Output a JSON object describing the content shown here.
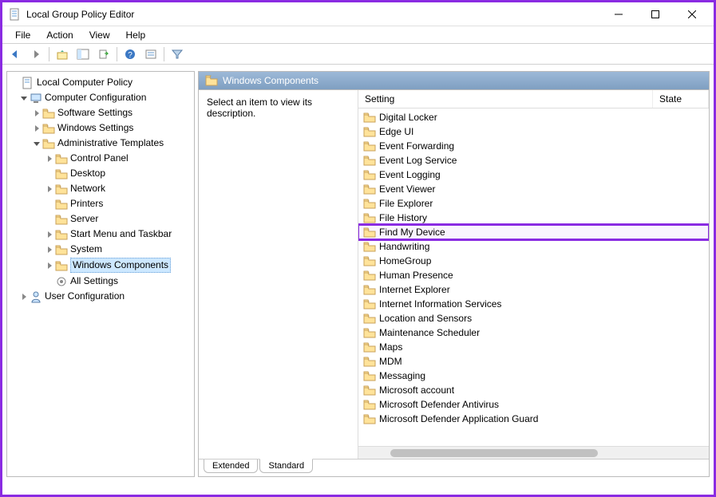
{
  "window": {
    "title": "Local Group Policy Editor"
  },
  "menu": {
    "items": [
      "File",
      "Action",
      "View",
      "Help"
    ]
  },
  "tree": {
    "root": "Local Computer Policy",
    "nodes": [
      {
        "label": "Computer Configuration",
        "level": 1,
        "twist": "open",
        "icon": "computer"
      },
      {
        "label": "Software Settings",
        "level": 2,
        "twist": "closed",
        "icon": "folder"
      },
      {
        "label": "Windows Settings",
        "level": 2,
        "twist": "closed",
        "icon": "folder"
      },
      {
        "label": "Administrative Templates",
        "level": 2,
        "twist": "open",
        "icon": "folder"
      },
      {
        "label": "Control Panel",
        "level": 3,
        "twist": "closed",
        "icon": "folder"
      },
      {
        "label": "Desktop",
        "level": 3,
        "twist": "none",
        "icon": "folder"
      },
      {
        "label": "Network",
        "level": 3,
        "twist": "closed",
        "icon": "folder"
      },
      {
        "label": "Printers",
        "level": 3,
        "twist": "none",
        "icon": "folder"
      },
      {
        "label": "Server",
        "level": 3,
        "twist": "none",
        "icon": "folder"
      },
      {
        "label": "Start Menu and Taskbar",
        "level": 3,
        "twist": "closed",
        "icon": "folder"
      },
      {
        "label": "System",
        "level": 3,
        "twist": "closed",
        "icon": "folder"
      },
      {
        "label": "Windows Components",
        "level": 3,
        "twist": "closed",
        "icon": "folder",
        "selected": true
      },
      {
        "label": "All Settings",
        "level": 3,
        "twist": "none",
        "icon": "settings"
      },
      {
        "label": "User Configuration",
        "level": 1,
        "twist": "closed",
        "icon": "user"
      }
    ]
  },
  "content": {
    "header": "Windows Components",
    "description_prompt": "Select an item to view its description.",
    "columns": {
      "setting": "Setting",
      "state": "State"
    },
    "items": [
      {
        "label": "Digital Locker"
      },
      {
        "label": "Edge UI"
      },
      {
        "label": "Event Forwarding"
      },
      {
        "label": "Event Log Service"
      },
      {
        "label": "Event Logging"
      },
      {
        "label": "Event Viewer"
      },
      {
        "label": "File Explorer"
      },
      {
        "label": "File History"
      },
      {
        "label": "Find My Device",
        "highlight": true
      },
      {
        "label": "Handwriting"
      },
      {
        "label": "HomeGroup"
      },
      {
        "label": "Human Presence"
      },
      {
        "label": "Internet Explorer"
      },
      {
        "label": "Internet Information Services"
      },
      {
        "label": "Location and Sensors"
      },
      {
        "label": "Maintenance Scheduler"
      },
      {
        "label": "Maps"
      },
      {
        "label": "MDM"
      },
      {
        "label": "Messaging"
      },
      {
        "label": "Microsoft account"
      },
      {
        "label": "Microsoft Defender Antivirus"
      },
      {
        "label": "Microsoft Defender Application Guard"
      }
    ],
    "tabs": {
      "extended": "Extended",
      "standard": "Standard"
    }
  }
}
